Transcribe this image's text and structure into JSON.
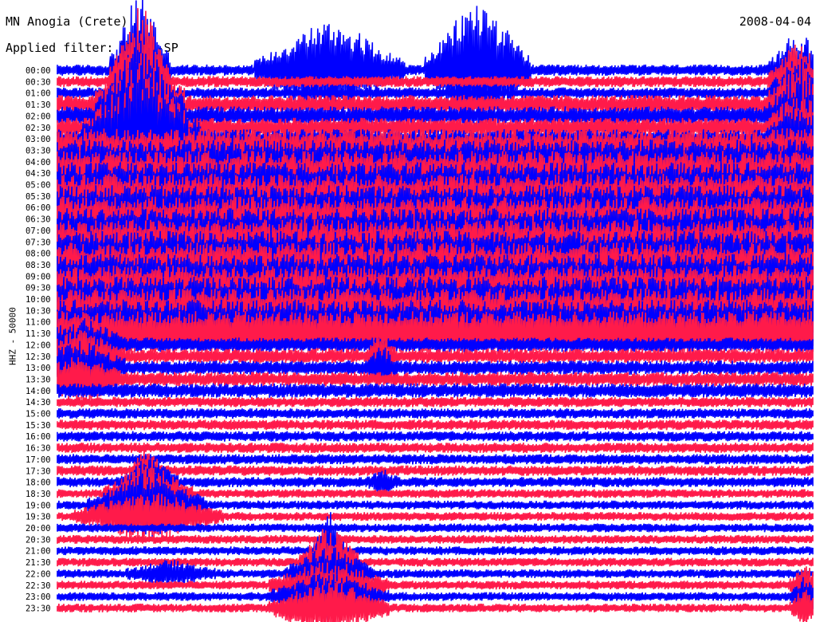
{
  "header": {
    "station": "MN Anogia (Crete)",
    "filter": "Applied filter: WWSSN-SP",
    "date": "2008-04-04",
    "channel": "HHZ - 50000"
  },
  "chart_data": {
    "type": "line",
    "title": "MN Anogia (Crete)",
    "subtitle": "Applied filter: WWSSN-SP",
    "ylabel": "HHZ - 50000",
    "xlabel": "",
    "tick_labels": [
      "00:00",
      "00:30",
      "01:00",
      "01:30",
      "02:00",
      "02:30",
      "03:00",
      "03:30",
      "04:00",
      "04:30",
      "05:00",
      "05:30",
      "06:00",
      "06:30",
      "07:00",
      "07:30",
      "08:00",
      "08:30",
      "09:00",
      "09:30",
      "10:00",
      "10:30",
      "11:00",
      "11:30",
      "12:00",
      "12:30",
      "13:00",
      "13:30",
      "14:00",
      "14:30",
      "15:00",
      "15:30",
      "16:00",
      "16:30",
      "17:00",
      "17:30",
      "18:00",
      "18:30",
      "19:00",
      "19:30",
      "20:00",
      "20:30",
      "21:00",
      "21:30",
      "22:00",
      "22:30",
      "23:00",
      "23:30"
    ],
    "trace_colors": [
      "#0000ff",
      "#ff1a4a"
    ],
    "grid": false,
    "legend": "none"
  }
}
